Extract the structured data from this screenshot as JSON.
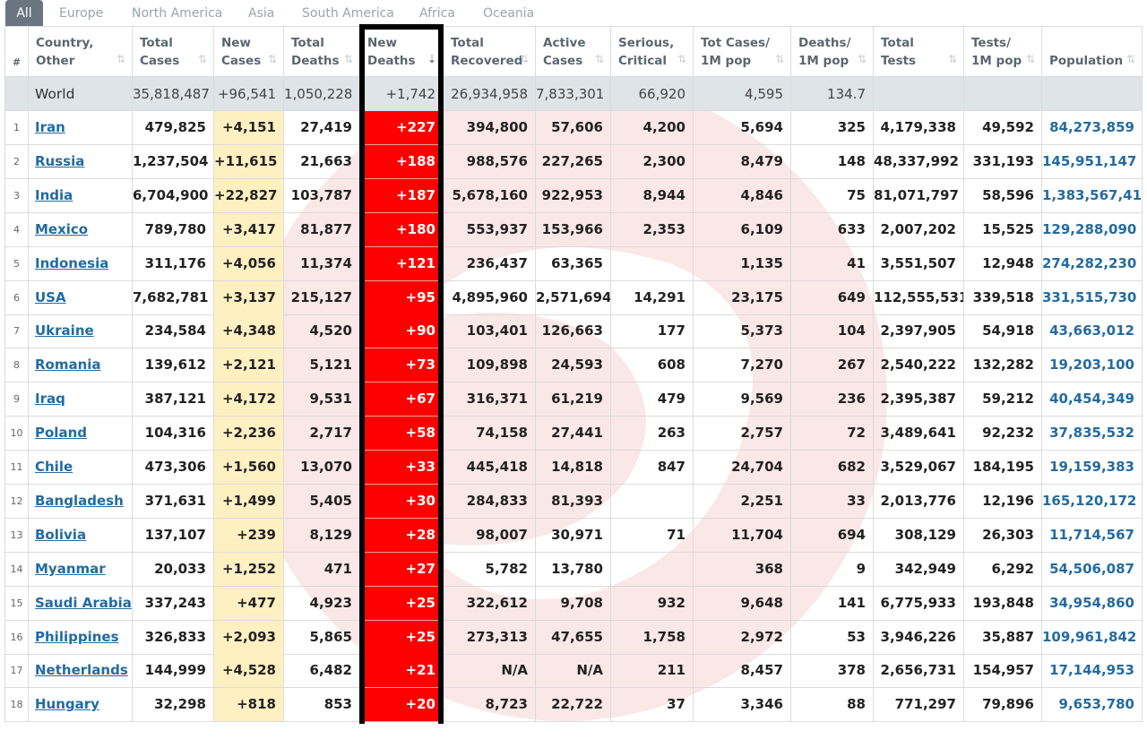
{
  "tabs": [
    "All",
    "Europe",
    "North America",
    "Asia",
    "South America",
    "Africa",
    "Oceania"
  ],
  "columns": {
    "num": "#",
    "country": [
      "Country,",
      "Other"
    ],
    "total_cases": [
      "Total",
      "Cases"
    ],
    "new_cases": [
      "New",
      "Cases"
    ],
    "total_deaths": [
      "Total",
      "Deaths"
    ],
    "new_deaths": [
      "New",
      "Deaths"
    ],
    "total_recovered": [
      "Total",
      "Recovered"
    ],
    "active_cases": [
      "Active",
      "Cases"
    ],
    "serious": [
      "Serious,",
      "Critical"
    ],
    "cases_per_m": [
      "Tot Cases/",
      "1M pop"
    ],
    "deaths_per_m": [
      "Deaths/",
      "1M pop"
    ],
    "total_tests": [
      "Total",
      "Tests"
    ],
    "tests_per_m": [
      "Tests/",
      "1M pop"
    ],
    "population": [
      "Population"
    ]
  },
  "icons": {
    "sort": "sort-icon",
    "sort_active": "sort-desc-icon"
  },
  "colors": {
    "new_cases_bg": "#fff0c2",
    "new_deaths_bg": "#ff0000",
    "world_row_bg": "#dfe4e8",
    "link": "#236ba1",
    "tab_active": "#6b7580"
  },
  "world": {
    "country": "World",
    "total_cases": "35,818,487",
    "new_cases": "+96,541",
    "total_deaths": "1,050,228",
    "new_deaths": "+1,742",
    "total_recovered": "26,934,958",
    "active_cases": "7,833,301",
    "serious": "66,920",
    "cases_per_m": "4,595",
    "deaths_per_m": "134.7",
    "total_tests": "",
    "tests_per_m": "",
    "population": ""
  },
  "rows": [
    {
      "num": "1",
      "country": "Iran",
      "total_cases": "479,825",
      "new_cases": "+4,151",
      "total_deaths": "27,419",
      "new_deaths": "+227",
      "total_recovered": "394,800",
      "active_cases": "57,606",
      "serious": "4,200",
      "cases_per_m": "5,694",
      "deaths_per_m": "325",
      "total_tests": "4,179,338",
      "tests_per_m": "49,592",
      "population": "84,273,859"
    },
    {
      "num": "2",
      "country": "Russia",
      "total_cases": "1,237,504",
      "new_cases": "+11,615",
      "total_deaths": "21,663",
      "new_deaths": "+188",
      "total_recovered": "988,576",
      "active_cases": "227,265",
      "serious": "2,300",
      "cases_per_m": "8,479",
      "deaths_per_m": "148",
      "total_tests": "48,337,992",
      "tests_per_m": "331,193",
      "population": "145,951,147"
    },
    {
      "num": "3",
      "country": "India",
      "total_cases": "6,704,900",
      "new_cases": "+22,827",
      "total_deaths": "103,787",
      "new_deaths": "+187",
      "total_recovered": "5,678,160",
      "active_cases": "922,953",
      "serious": "8,944",
      "cases_per_m": "4,846",
      "deaths_per_m": "75",
      "total_tests": "81,071,797",
      "tests_per_m": "58,596",
      "population": "1,383,567,415"
    },
    {
      "num": "4",
      "country": "Mexico",
      "total_cases": "789,780",
      "new_cases": "+3,417",
      "total_deaths": "81,877",
      "new_deaths": "+180",
      "total_recovered": "553,937",
      "active_cases": "153,966",
      "serious": "2,353",
      "cases_per_m": "6,109",
      "deaths_per_m": "633",
      "total_tests": "2,007,202",
      "tests_per_m": "15,525",
      "population": "129,288,090"
    },
    {
      "num": "5",
      "country": "Indonesia",
      "total_cases": "311,176",
      "new_cases": "+4,056",
      "total_deaths": "11,374",
      "new_deaths": "+121",
      "total_recovered": "236,437",
      "active_cases": "63,365",
      "serious": "",
      "cases_per_m": "1,135",
      "deaths_per_m": "41",
      "total_tests": "3,551,507",
      "tests_per_m": "12,948",
      "population": "274,282,230"
    },
    {
      "num": "6",
      "country": "USA",
      "total_cases": "7,682,781",
      "new_cases": "+3,137",
      "total_deaths": "215,127",
      "new_deaths": "+95",
      "total_recovered": "4,895,960",
      "active_cases": "2,571,694",
      "serious": "14,291",
      "cases_per_m": "23,175",
      "deaths_per_m": "649",
      "total_tests": "112,555,531",
      "tests_per_m": "339,518",
      "population": "331,515,730"
    },
    {
      "num": "7",
      "country": "Ukraine",
      "total_cases": "234,584",
      "new_cases": "+4,348",
      "total_deaths": "4,520",
      "new_deaths": "+90",
      "total_recovered": "103,401",
      "active_cases": "126,663",
      "serious": "177",
      "cases_per_m": "5,373",
      "deaths_per_m": "104",
      "total_tests": "2,397,905",
      "tests_per_m": "54,918",
      "population": "43,663,012"
    },
    {
      "num": "8",
      "country": "Romania",
      "total_cases": "139,612",
      "new_cases": "+2,121",
      "total_deaths": "5,121",
      "new_deaths": "+73",
      "total_recovered": "109,898",
      "active_cases": "24,593",
      "serious": "608",
      "cases_per_m": "7,270",
      "deaths_per_m": "267",
      "total_tests": "2,540,222",
      "tests_per_m": "132,282",
      "population": "19,203,100"
    },
    {
      "num": "9",
      "country": "Iraq",
      "total_cases": "387,121",
      "new_cases": "+4,172",
      "total_deaths": "9,531",
      "new_deaths": "+67",
      "total_recovered": "316,371",
      "active_cases": "61,219",
      "serious": "479",
      "cases_per_m": "9,569",
      "deaths_per_m": "236",
      "total_tests": "2,395,387",
      "tests_per_m": "59,212",
      "population": "40,454,349"
    },
    {
      "num": "10",
      "country": "Poland",
      "total_cases": "104,316",
      "new_cases": "+2,236",
      "total_deaths": "2,717",
      "new_deaths": "+58",
      "total_recovered": "74,158",
      "active_cases": "27,441",
      "serious": "263",
      "cases_per_m": "2,757",
      "deaths_per_m": "72",
      "total_tests": "3,489,641",
      "tests_per_m": "92,232",
      "population": "37,835,532"
    },
    {
      "num": "11",
      "country": "Chile",
      "total_cases": "473,306",
      "new_cases": "+1,560",
      "total_deaths": "13,070",
      "new_deaths": "+33",
      "total_recovered": "445,418",
      "active_cases": "14,818",
      "serious": "847",
      "cases_per_m": "24,704",
      "deaths_per_m": "682",
      "total_tests": "3,529,067",
      "tests_per_m": "184,195",
      "population": "19,159,383"
    },
    {
      "num": "12",
      "country": "Bangladesh",
      "total_cases": "371,631",
      "new_cases": "+1,499",
      "total_deaths": "5,405",
      "new_deaths": "+30",
      "total_recovered": "284,833",
      "active_cases": "81,393",
      "serious": "",
      "cases_per_m": "2,251",
      "deaths_per_m": "33",
      "total_tests": "2,013,776",
      "tests_per_m": "12,196",
      "population": "165,120,172"
    },
    {
      "num": "13",
      "country": "Bolivia",
      "total_cases": "137,107",
      "new_cases": "+239",
      "total_deaths": "8,129",
      "new_deaths": "+28",
      "total_recovered": "98,007",
      "active_cases": "30,971",
      "serious": "71",
      "cases_per_m": "11,704",
      "deaths_per_m": "694",
      "total_tests": "308,129",
      "tests_per_m": "26,303",
      "population": "11,714,567"
    },
    {
      "num": "14",
      "country": "Myanmar",
      "total_cases": "20,033",
      "new_cases": "+1,252",
      "total_deaths": "471",
      "new_deaths": "+27",
      "total_recovered": "5,782",
      "active_cases": "13,780",
      "serious": "",
      "cases_per_m": "368",
      "deaths_per_m": "9",
      "total_tests": "342,949",
      "tests_per_m": "6,292",
      "population": "54,506,087"
    },
    {
      "num": "15",
      "country": "Saudi Arabia",
      "total_cases": "337,243",
      "new_cases": "+477",
      "total_deaths": "4,923",
      "new_deaths": "+25",
      "total_recovered": "322,612",
      "active_cases": "9,708",
      "serious": "932",
      "cases_per_m": "9,648",
      "deaths_per_m": "141",
      "total_tests": "6,775,933",
      "tests_per_m": "193,848",
      "population": "34,954,860"
    },
    {
      "num": "16",
      "country": "Philippines",
      "total_cases": "326,833",
      "new_cases": "+2,093",
      "total_deaths": "5,865",
      "new_deaths": "+25",
      "total_recovered": "273,313",
      "active_cases": "47,655",
      "serious": "1,758",
      "cases_per_m": "2,972",
      "deaths_per_m": "53",
      "total_tests": "3,946,226",
      "tests_per_m": "35,887",
      "population": "109,961,842"
    },
    {
      "num": "17",
      "country": "Netherlands",
      "total_cases": "144,999",
      "new_cases": "+4,528",
      "total_deaths": "6,482",
      "new_deaths": "+21",
      "total_recovered": "N/A",
      "active_cases": "N/A",
      "serious": "211",
      "cases_per_m": "8,457",
      "deaths_per_m": "378",
      "total_tests": "2,656,731",
      "tests_per_m": "154,957",
      "population": "17,144,953"
    },
    {
      "num": "18",
      "country": "Hungary",
      "total_cases": "32,298",
      "new_cases": "+818",
      "total_deaths": "853",
      "new_deaths": "+20",
      "total_recovered": "8,723",
      "active_cases": "22,722",
      "serious": "37",
      "cases_per_m": "3,346",
      "deaths_per_m": "88",
      "total_tests": "771,297",
      "tests_per_m": "79,896",
      "population": "9,653,780"
    }
  ]
}
